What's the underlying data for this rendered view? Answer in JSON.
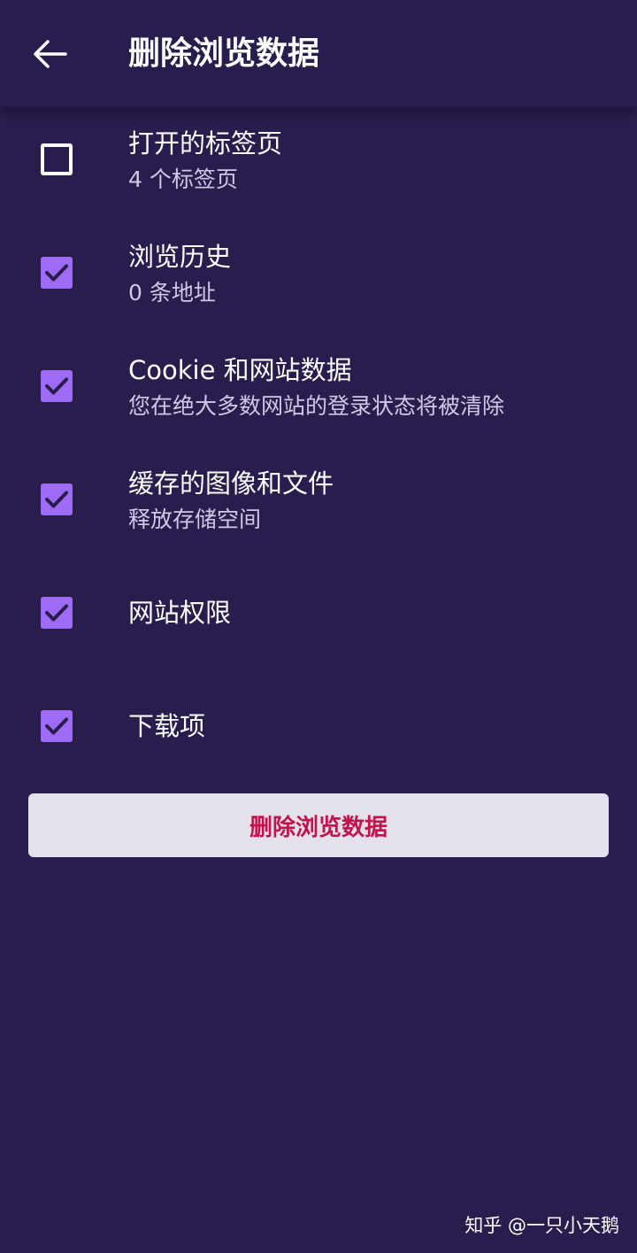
{
  "colors": {
    "background": "#291d4d",
    "checkbox_checked": "#9d6bf4",
    "checkmark": "#291d4d",
    "subtitle_text": "#cfc8e6",
    "button_background": "#e4e1ea",
    "button_text": "#c3134d"
  },
  "header": {
    "back_icon": "arrow-left-icon",
    "title": "删除浏览数据"
  },
  "options": [
    {
      "title": "打开的标签页",
      "subtitle": "4 个标签页",
      "checked": false
    },
    {
      "title": "浏览历史",
      "subtitle": "0 条地址",
      "checked": true
    },
    {
      "title": "Cookie 和网站数据",
      "subtitle": "您在绝大多数网站的登录状态将被清除",
      "checked": true
    },
    {
      "title": "缓存的图像和文件",
      "subtitle": "释放存储空间",
      "checked": true
    },
    {
      "title": "网站权限",
      "subtitle": "",
      "checked": true
    },
    {
      "title": "下载项",
      "subtitle": "",
      "checked": true
    }
  ],
  "delete_button": {
    "label": "删除浏览数据"
  },
  "watermark": {
    "text": "知乎 @一只小天鹅"
  }
}
